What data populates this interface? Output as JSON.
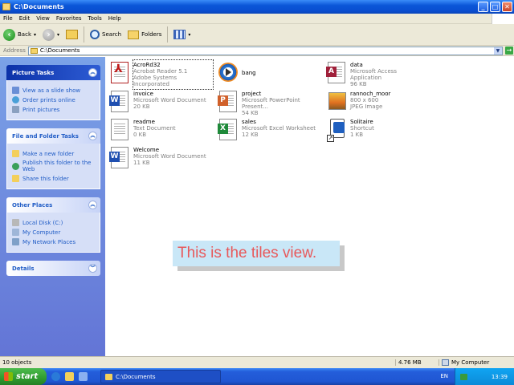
{
  "window": {
    "title": "C:\\Documents",
    "buttons": {
      "minimize": "_",
      "maximize": "□",
      "close": "✕"
    }
  },
  "menu": [
    "File",
    "Edit",
    "View",
    "Favorites",
    "Tools",
    "Help"
  ],
  "toolbar": {
    "back": "Back",
    "search": "Search",
    "folders": "Folders"
  },
  "address": {
    "label": "Address",
    "value": "C:\\Documents",
    "go": "Go"
  },
  "taskpane": {
    "picture_tasks": {
      "title": "Picture Tasks",
      "links": [
        "View as a slide show",
        "Order prints online",
        "Print pictures"
      ]
    },
    "file_tasks": {
      "title": "File and Folder Tasks",
      "links": [
        "Make a new folder",
        "Publish this folder to the Web",
        "Share this folder"
      ]
    },
    "other_places": {
      "title": "Other Places",
      "links": [
        "Local Disk (C:)",
        "My Computer",
        "My Network Places"
      ]
    },
    "details": {
      "title": "Details"
    }
  },
  "files": [
    {
      "name": "AcroRd32",
      "l2": "Acrobat Reader 5.1",
      "l3": "Adobe Systems Incorporated",
      "icon": "acrobat-icon"
    },
    {
      "name": "bang",
      "l2": "",
      "l3": "",
      "icon": "media-player-icon"
    },
    {
      "name": "data",
      "l2": "Microsoft Access Application",
      "l3": "96 KB",
      "icon": "access-icon"
    },
    {
      "name": "invoice",
      "l2": "Microsoft Word Document",
      "l3": "20 KB",
      "icon": "word-icon"
    },
    {
      "name": "project",
      "l2": "Microsoft PowerPoint Present...",
      "l3": "54 KB",
      "icon": "powerpoint-icon"
    },
    {
      "name": "rannoch_moor",
      "l2": "800 x 600",
      "l3": "JPEG Image",
      "icon": "jpeg-image-icon"
    },
    {
      "name": "readme",
      "l2": "Text Document",
      "l3": "0 KB",
      "icon": "text-document-icon"
    },
    {
      "name": "sales",
      "l2": "Microsoft Excel Worksheet",
      "l3": "12 KB",
      "icon": "excel-icon"
    },
    {
      "name": "Solitaire",
      "l2": "Shortcut",
      "l3": "1 KB",
      "icon": "solitaire-shortcut-icon"
    },
    {
      "name": "Welcome",
      "l2": "Microsoft Word Document",
      "l3": "11 KB",
      "icon": "word-icon"
    }
  ],
  "overlay": "This is the tiles view.",
  "status": {
    "objects": "10 objects",
    "size": "4.76 MB",
    "location": "My Computer"
  },
  "taskbar": {
    "start": "start",
    "task": "C:\\Documents",
    "lang": "EN",
    "clock": "13:39"
  }
}
